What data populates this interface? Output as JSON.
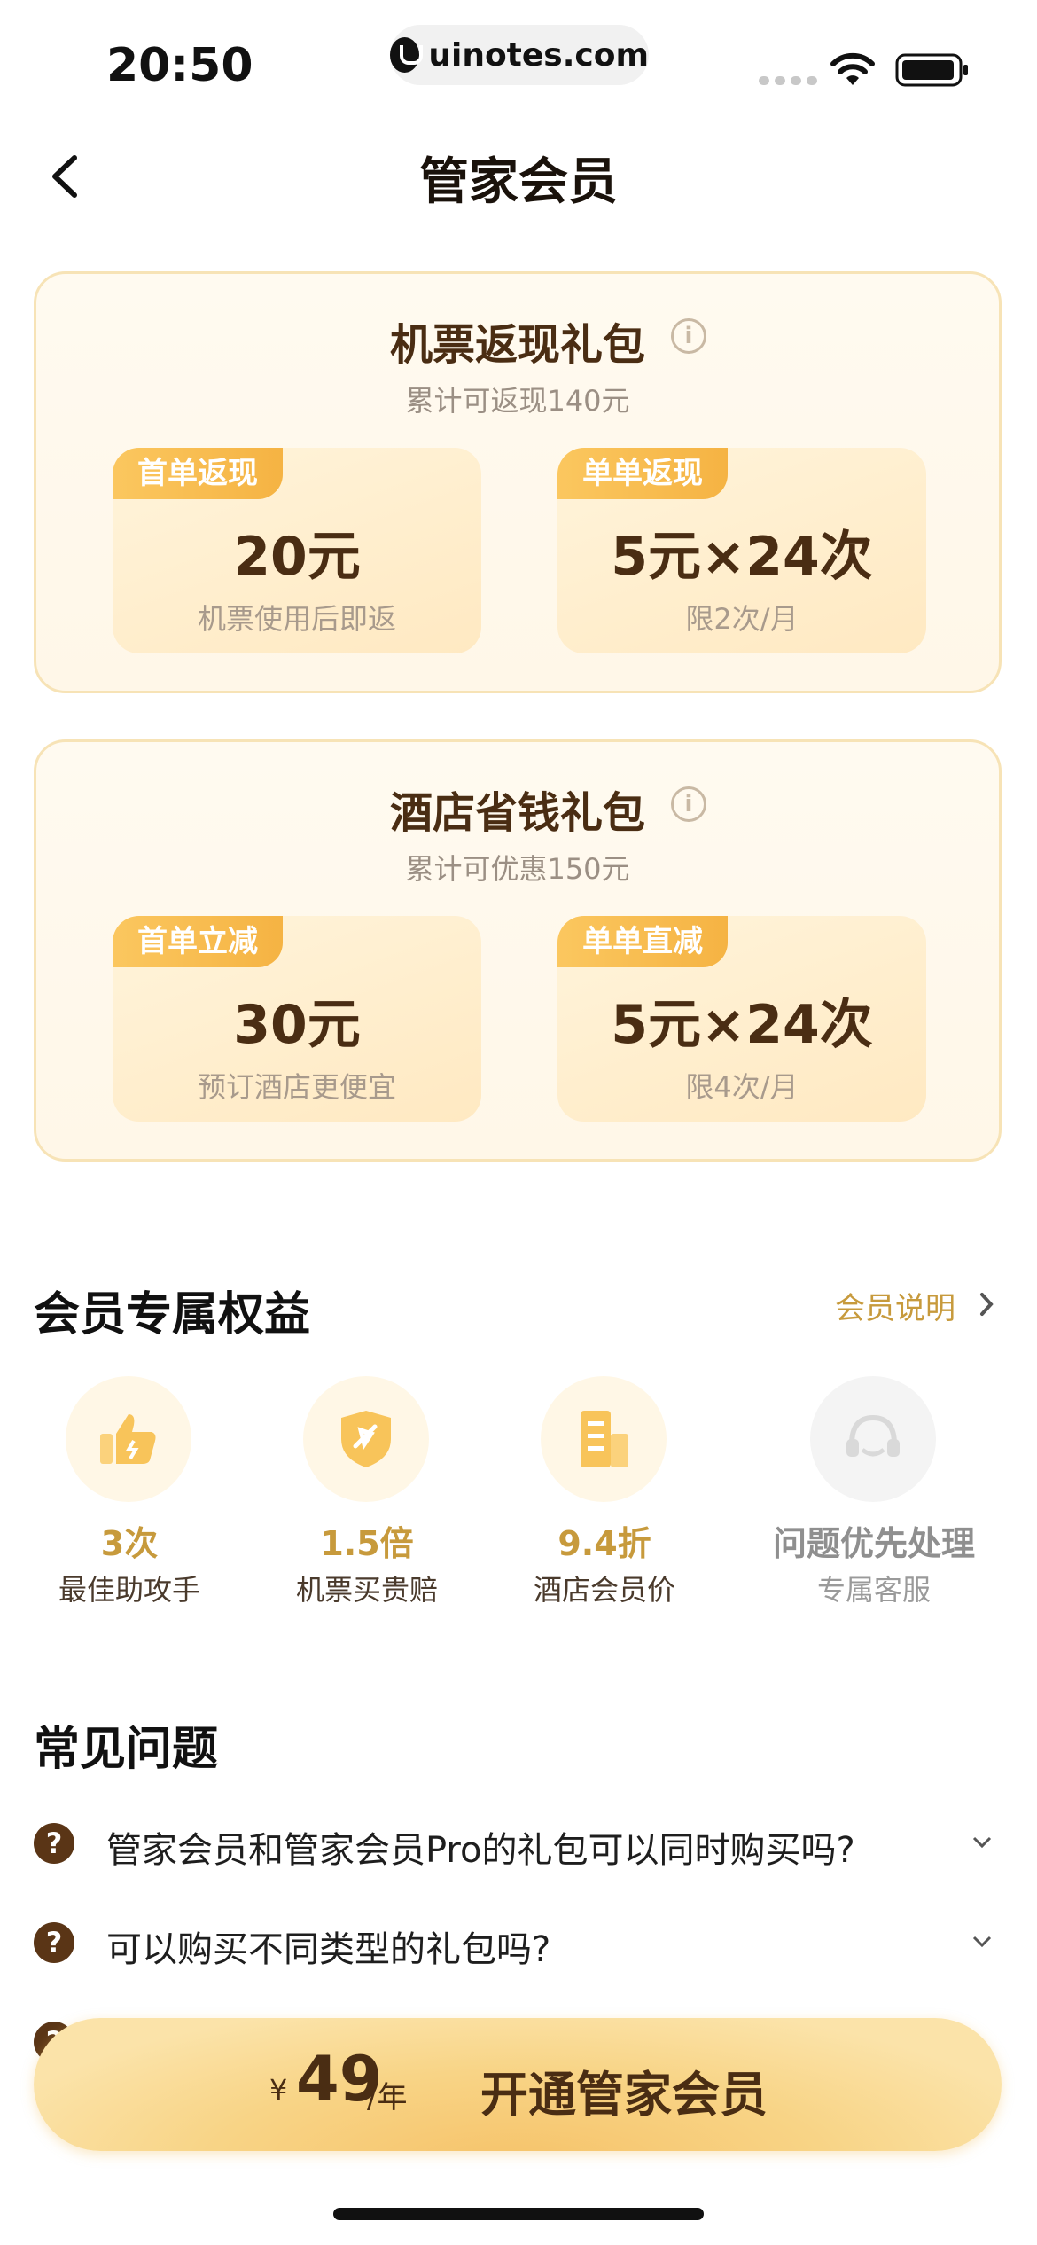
{
  "status_bar": {
    "time": "20:50",
    "url": "uinotes.com"
  },
  "header": {
    "title": "管家会员"
  },
  "flight_package": {
    "title": "机票返现礼包",
    "subtitle": "累计可返现140元",
    "tiles": [
      {
        "tag": "首单返现",
        "value": "20元",
        "note": "机票使用后即返"
      },
      {
        "tag": "单单返现",
        "value": "5元×24次",
        "note": "限2次/月"
      }
    ]
  },
  "hotel_package": {
    "title": "酒店省钱礼包",
    "subtitle": "累计可优惠150元",
    "tiles": [
      {
        "tag": "首单立减",
        "value": "30元",
        "note": "预订酒店更便宜"
      },
      {
        "tag": "单单直减",
        "value": "5元×24次",
        "note": "限4次/月"
      }
    ]
  },
  "benefits": {
    "title": "会员专属权益",
    "more": "会员说明",
    "items": [
      {
        "value": "3次",
        "label": "最佳助攻手",
        "icon": "thumbs-up-icon"
      },
      {
        "value": "1.5倍",
        "label": "机票买贵赔",
        "icon": "plane-shield-icon"
      },
      {
        "value": "9.4折",
        "label": "酒店会员价",
        "icon": "hotel-building-icon"
      },
      {
        "value": "问题优先处理",
        "label": "专属客服",
        "icon": "headset-icon"
      }
    ]
  },
  "faq": {
    "title": "常见问题",
    "items": [
      {
        "question": "管家会员和管家会员Pro的礼包可以同时购买吗?"
      },
      {
        "question": "可以购买不同类型的礼包吗?"
      }
    ]
  },
  "cta": {
    "currency": "¥",
    "price": "49",
    "unit": "/年",
    "label": "开通管家会员"
  },
  "colors": {
    "accent": "#c79a3c",
    "brown": "#4a2d13",
    "tag": "#f5b343"
  }
}
